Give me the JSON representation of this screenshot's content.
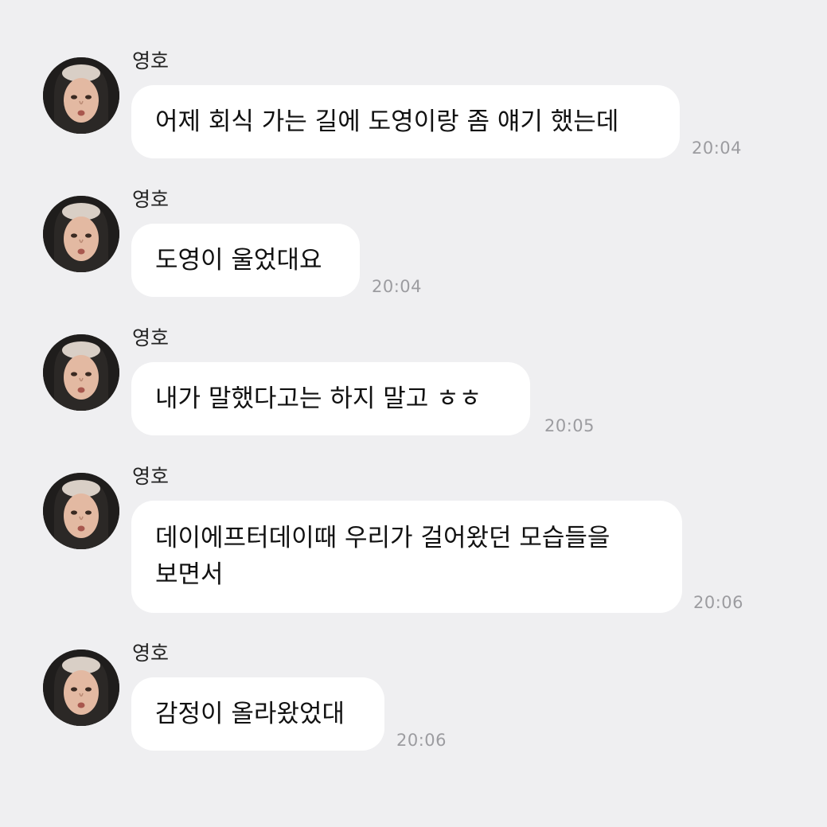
{
  "messages": [
    {
      "sender": "영호",
      "lines": [
        "어제 회식 가는 길에 도영이랑 좀 얘기 했는데"
      ],
      "time": "20:04"
    },
    {
      "sender": "영호",
      "lines": [
        "도영이 울었대요"
      ],
      "time": "20:04"
    },
    {
      "sender": "영호",
      "lines": [
        "내가 말했다고는 하지 말고 ㅎㅎ"
      ],
      "time": "20:05"
    },
    {
      "sender": "영호",
      "lines": [
        "데이에프터데이때 우리가 걸어왔던 모습들을",
        "보면서"
      ],
      "time": "20:06"
    },
    {
      "sender": "영호",
      "lines": [
        "감정이 올라왔었대"
      ],
      "time": "20:06"
    }
  ],
  "colors": {
    "background": "#efeff1",
    "bubble": "#ffffff",
    "text": "#111111",
    "timestamp": "#9c9ca0"
  }
}
